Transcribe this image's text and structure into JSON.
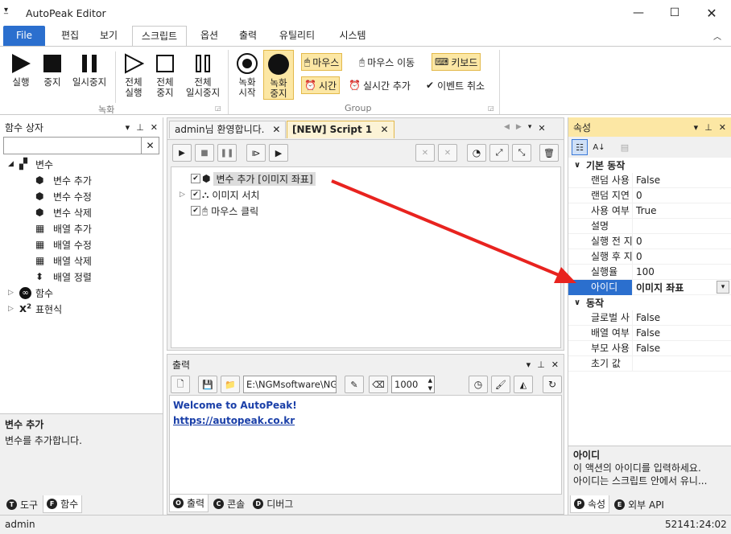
{
  "app": {
    "title": "AutoPeak Editor"
  },
  "ribbon_tabs": [
    "File",
    "편집",
    "보기",
    "스크립트",
    "옵션",
    "출력",
    "유틸리티",
    "시스템"
  ],
  "ribbon": {
    "groups": {
      "record": "녹화",
      "group": "Group"
    },
    "buttons": {
      "run": "실행",
      "stop": "중지",
      "pause": "일시중지",
      "run_all_1": "전체",
      "run_all_2": "실행",
      "stop_all_1": "전체",
      "stop_all_2": "중지",
      "pause_all_1": "전체",
      "pause_all_2": "일시중지",
      "rec_start_1": "녹화",
      "rec_start_2": "시작",
      "rec_stop_1": "녹화",
      "rec_stop_2": "중지",
      "mouse": "마우스",
      "mouse_move": "마우스 이동",
      "keyboard": "키보드",
      "time": "시간",
      "realtime_add": "실시간 추가",
      "event_cancel": "이벤트 취소"
    }
  },
  "left_panel": {
    "title": "함수 상자",
    "search": {
      "value": "",
      "placeholder": ""
    },
    "tree": {
      "variables": "변수",
      "var_items": [
        "변수 추가",
        "변수 수정",
        "변수 삭제",
        "배열 추가",
        "배열 수정",
        "배열 삭제",
        "배열 정렬"
      ],
      "functions": "함수",
      "expressions": "표현식"
    },
    "desc_title": "변수 추가",
    "desc_text": "변수를 추가합니다.",
    "tabs": [
      "도구",
      "함수"
    ]
  },
  "editor": {
    "tabs": [
      "admin님 환영합니다.",
      "[NEW] Script 1"
    ],
    "items": [
      {
        "label": "변수 추가 [이미지 좌표]",
        "selected": true
      },
      {
        "label": "이미지 서치",
        "selected": false
      },
      {
        "label": "마우스 클릭",
        "selected": false
      }
    ]
  },
  "output": {
    "title": "출력",
    "path": "E:\\NGMsoftware\\NG",
    "count": "1000",
    "lines": [
      "Welcome to AutoPeak!",
      "https://autopeak.co.kr"
    ],
    "tabs": [
      "출력",
      "콘솔",
      "디버그"
    ]
  },
  "right_panel": {
    "title": "속성",
    "categories": [
      {
        "name": "기본 동작",
        "rows": [
          {
            "key": "랜덤 사용",
            "value": "False"
          },
          {
            "key": "랜덤 지연",
            "value": "0"
          },
          {
            "key": "사용 여부",
            "value": "True"
          },
          {
            "key": "설명",
            "value": ""
          },
          {
            "key": "실행 전 지",
            "value": "0"
          },
          {
            "key": "실행 후 지",
            "value": "0"
          },
          {
            "key": "실행율",
            "value": "100"
          },
          {
            "key": "아이디",
            "value": "이미지 좌표"
          }
        ]
      },
      {
        "name": "동작",
        "rows": [
          {
            "key": "글로벌 사",
            "value": "False"
          },
          {
            "key": "배열 여부",
            "value": "False"
          },
          {
            "key": "부모 사용",
            "value": "False"
          },
          {
            "key": "초기 값",
            "value": ""
          }
        ]
      }
    ],
    "desc_title": "아이디",
    "desc_line1": "이 액션의 아이디를 입력하세요.",
    "desc_line2": "아이디는 스크립트 안에서 유니...",
    "tabs": [
      "속성",
      "외부 API"
    ]
  },
  "status": {
    "user": "admin",
    "time": "52141:24:02"
  },
  "colors": {
    "accent": "#2b6fce",
    "highlight": "#fce7a4",
    "arrow": "#e8231f",
    "link": "#1a3fa8"
  }
}
